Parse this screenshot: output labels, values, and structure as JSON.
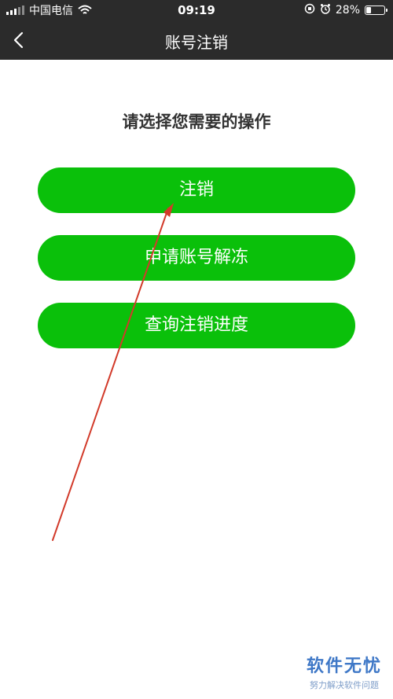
{
  "status_bar": {
    "carrier": "中国电信",
    "time": "09:19",
    "battery": "28%",
    "battery_level": 0.28
  },
  "nav": {
    "title": "账号注销",
    "back_icon": "chevron-left-icon"
  },
  "prompt": "请选择您需要的操作",
  "buttons": [
    {
      "label": "注销"
    },
    {
      "label": "申请账号解冻"
    },
    {
      "label": "查询注销进度"
    }
  ],
  "watermark": {
    "main": "软件无忧",
    "sub": "努力解决软件问题"
  },
  "colors": {
    "accent": "#0ac00a",
    "nav_bg": "#2b2b2b",
    "annotation": "#d23a2a",
    "watermark": "#3f78c7"
  }
}
